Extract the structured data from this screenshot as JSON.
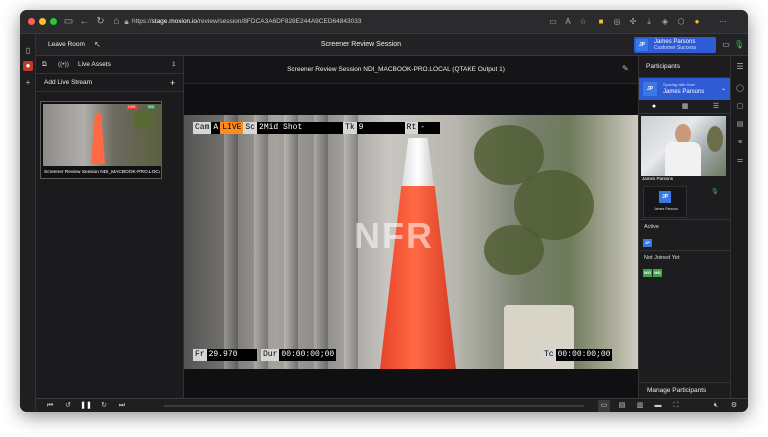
{
  "browser": {
    "url_scheme": "https://",
    "url_host": "stage.moxion.io",
    "url_path": "/review/session/8FDCA3A6DF828E244A9CED64843033",
    "traffic_lights": [
      "#ff5f57",
      "#febc2e",
      "#28c840"
    ],
    "nav_icons": [
      "sidebar-icon",
      "back-arrow-icon",
      "refresh-icon",
      "home-icon"
    ],
    "ext_icons": [
      "cast-icon",
      "translate-icon",
      "star-icon",
      "extension-yellow-icon",
      "extension-icon",
      "puzzle-icon",
      "download-icon",
      "pocket-icon",
      "shield-icon",
      "account-icon",
      "more-icon"
    ]
  },
  "header": {
    "leave_label": "Leave Room",
    "title": "Screener Review Session",
    "user": {
      "initials": "JP",
      "name": "James Parsons",
      "role": "Customer Success"
    },
    "accent": "#2f5bd6"
  },
  "left": {
    "assets_label": "Live Assets",
    "assets_count": "1",
    "add_label": "Add Live Stream",
    "add_symbol": "+",
    "thumb": {
      "label": "Screener Review Session NDI_MACBOOK-PRO.LOCAL (QT",
      "badge_live": "LIVE",
      "badge_ndi": "NDI"
    }
  },
  "center": {
    "stream_title": "Screener Review Session NDI_MACBOOK-PRO.LOCAL (QTAKE Output 1)",
    "overlay": {
      "cam_key": "Cam",
      "cam_val": "A",
      "live": "LIVE",
      "sc_key": "Sc",
      "sc_val": "2Mid Shot",
      "tk_key": "Tk",
      "tk_val": "9",
      "rt_key": "Rt",
      "rt_val": "-",
      "fr_key": "Fr",
      "fr_val": "29.970",
      "dur_key": "Dur",
      "dur_val": "00:00:00;00",
      "tc_key": "Tc",
      "tc_val": "00:00:00;00",
      "watermark": "NFR"
    }
  },
  "right": {
    "participants_label": "Participants",
    "speaker_sub": "Syncing with Host",
    "speaker_name": "James Parsons",
    "speaker_initials": "JP",
    "tab_icons": [
      "person-icon",
      "grid-icon",
      "list-icon"
    ],
    "cam_name": "James Parsons",
    "tile_name": "James Parsons",
    "tile_initials": "JP",
    "active_label": "Active",
    "active_initials": "JP",
    "not_joined_label": "Not Joined Yet",
    "not_joined": [
      {
        "initials": "WG",
        "color": "#3fa34d"
      },
      {
        "initials": "MG",
        "color": "#3fa34d"
      }
    ],
    "manage_label": "Manage Participants",
    "manage_symbol": "+"
  },
  "farrail": {
    "icons": [
      "people-icon",
      "chat-bubble-icon",
      "notes-icon",
      "list-filter-icon",
      "sliders-icon"
    ]
  },
  "player": {
    "progress": 0.0,
    "icons": [
      "skip-back-icon",
      "rewind-icon",
      "pause-icon",
      "forward-icon",
      "skip-forward-icon",
      "layout-single-icon",
      "layout-grid-icon",
      "layout-side-icon",
      "layout-wide-icon",
      "fullscreen-icon",
      "volume-mute-icon",
      "settings-icon"
    ]
  }
}
